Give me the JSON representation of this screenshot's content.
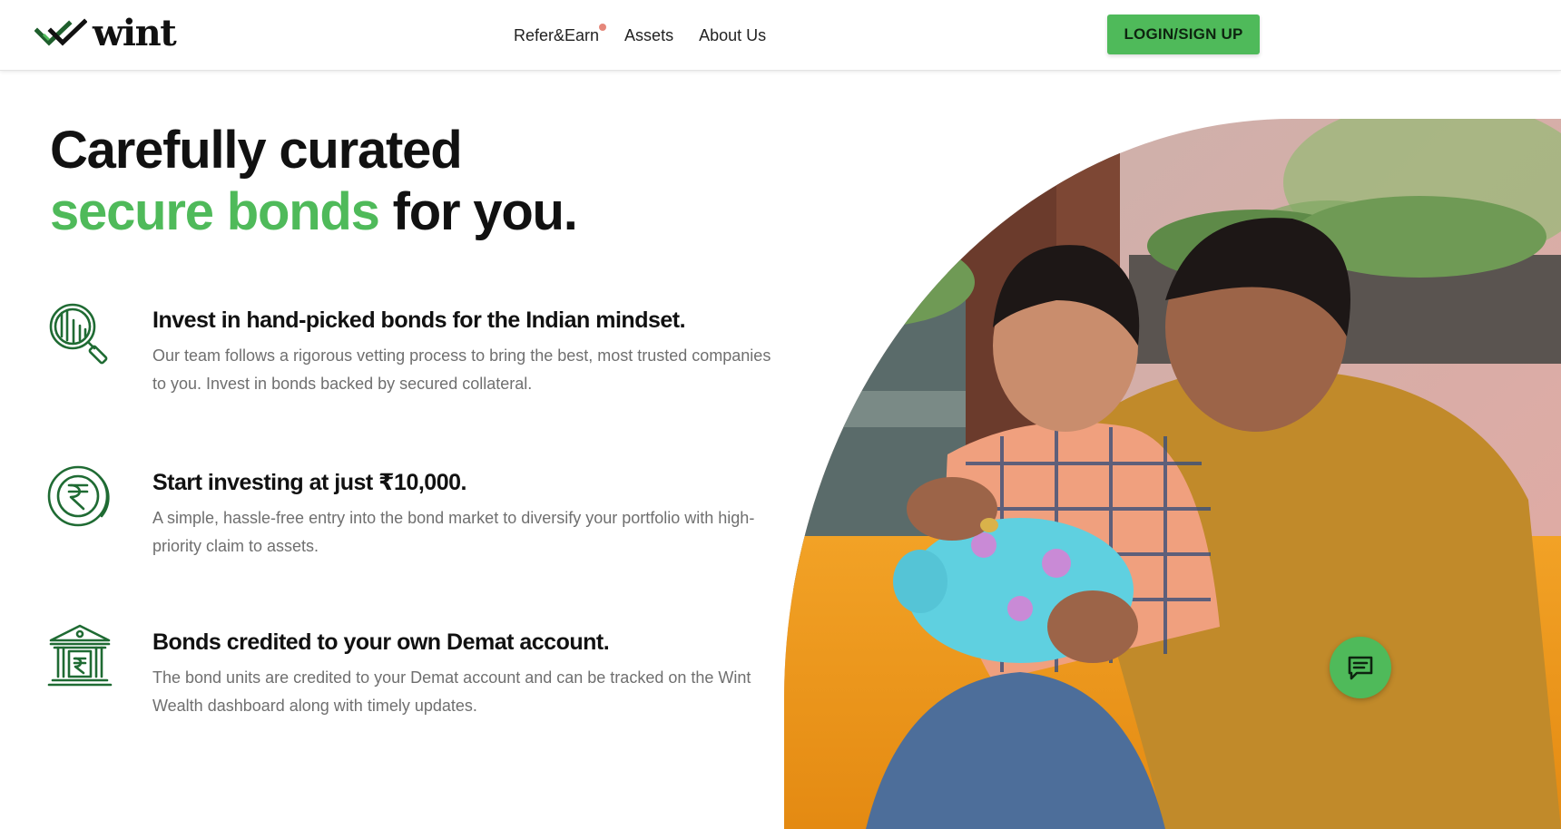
{
  "header": {
    "logo_text": "wint",
    "logo_icon": "double-check-logo-icon",
    "nav": [
      {
        "label": "Refer&Earn",
        "has_notification_dot": true
      },
      {
        "label": "Assets"
      },
      {
        "label": "About Us"
      }
    ],
    "login_label": "LOGIN/SIGN UP"
  },
  "hero": {
    "title_line1": "Carefully curated",
    "title_highlight": "secure bonds",
    "title_rest": " for you."
  },
  "features": [
    {
      "icon": "bond-research-icon",
      "title": "Invest in hand-picked bonds for the Indian mindset.",
      "body": "Our team follows a rigorous vetting process to bring the best, most trusted companies to you. Invest in bonds backed by secured collateral."
    },
    {
      "icon": "rupee-coin-icon",
      "title": "Start investing at just ₹10,000.",
      "body": "A simple, hassle-free entry into the bond market to diversify your portfolio with high-priority claim to assets."
    },
    {
      "icon": "bank-rupee-icon",
      "title": "Bonds credited to your own Demat account.",
      "body": "The bond units are credited to your Demat account and can be tracked on the Wint Wealth dashboard along with timely updates."
    }
  ],
  "hero_image": {
    "subject": "father-and-son-with-piggy-bank-photo"
  },
  "chat": {
    "icon": "chat-bubble-icon"
  },
  "colors": {
    "brand_green": "#4fba5a",
    "icon_green": "#1f6b33",
    "body_text": "#6f6f6f",
    "notification_dot": "#e5877a"
  }
}
